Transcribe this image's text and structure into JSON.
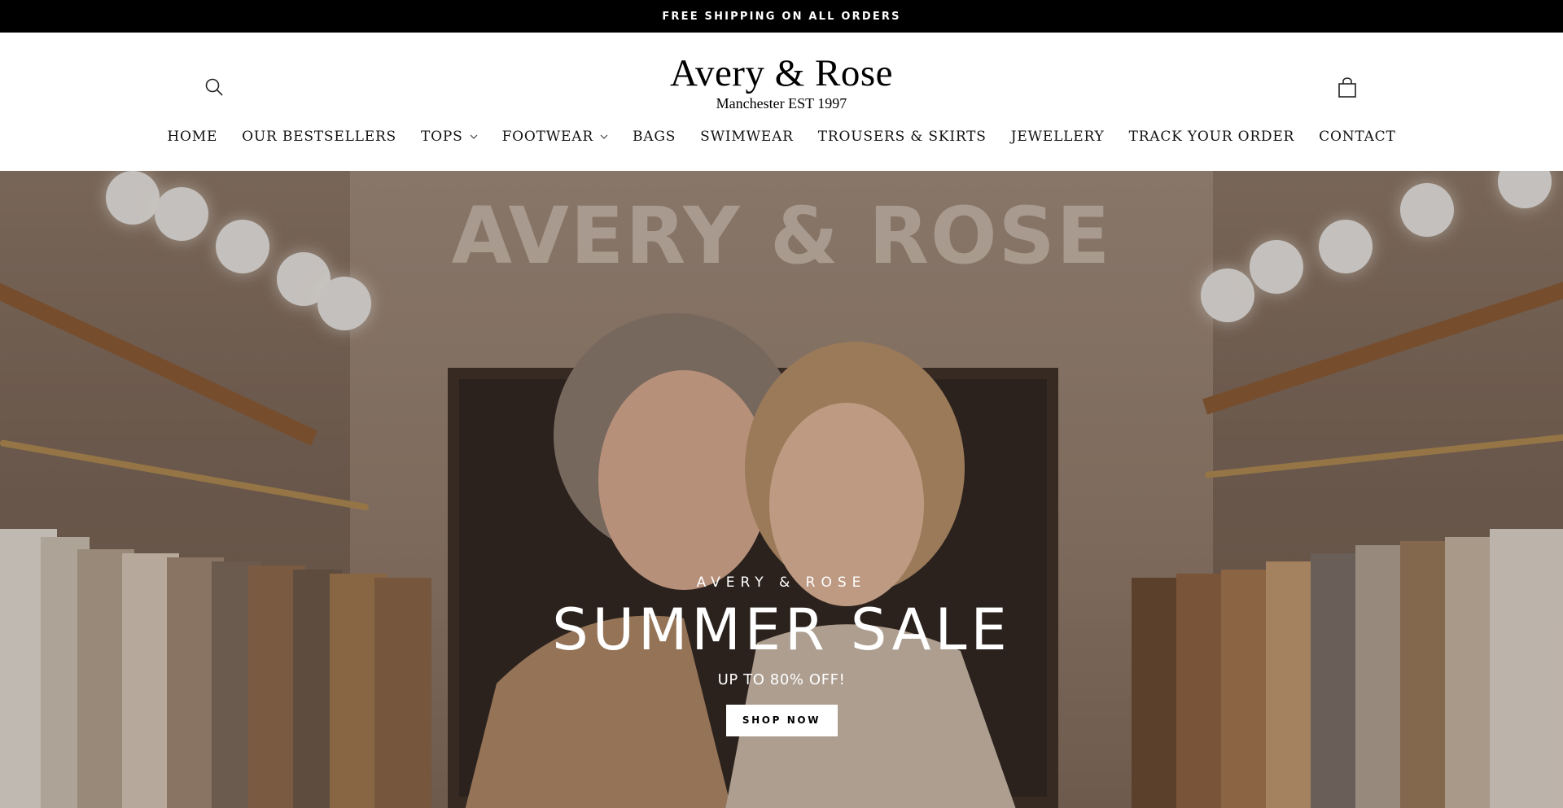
{
  "announcement": {
    "text": "FREE SHIPPING ON ALL ORDERS"
  },
  "header": {
    "logo_name": "Avery & Rose",
    "logo_tagline": "Manchester EST 1997",
    "icons": {
      "search": "search-icon",
      "cart": "shopping-bag-icon"
    }
  },
  "nav": {
    "items": [
      {
        "label": "HOME",
        "dropdown": false
      },
      {
        "label": "OUR BESTSELLERS",
        "dropdown": false
      },
      {
        "label": "TOPS",
        "dropdown": true
      },
      {
        "label": "FOOTWEAR",
        "dropdown": true
      },
      {
        "label": "BAGS",
        "dropdown": false
      },
      {
        "label": "SWIMWEAR",
        "dropdown": false
      },
      {
        "label": "TROUSERS & SKIRTS",
        "dropdown": false
      },
      {
        "label": "JEWELLERY",
        "dropdown": false
      },
      {
        "label": "TRACK YOUR ORDER",
        "dropdown": false
      },
      {
        "label": "CONTACT",
        "dropdown": false
      }
    ]
  },
  "hero": {
    "sign_text": "AVERY & ROSE",
    "eyebrow": "AVERY & ROSE",
    "title": "SUMMER SALE",
    "subtitle": "UP TO 80% OFF!",
    "cta_label": "SHOP NOW"
  },
  "colors": {
    "announcement_bg": "#000000",
    "text": "#111111",
    "hero_text": "#ffffff",
    "cta_bg": "#ffffff"
  }
}
